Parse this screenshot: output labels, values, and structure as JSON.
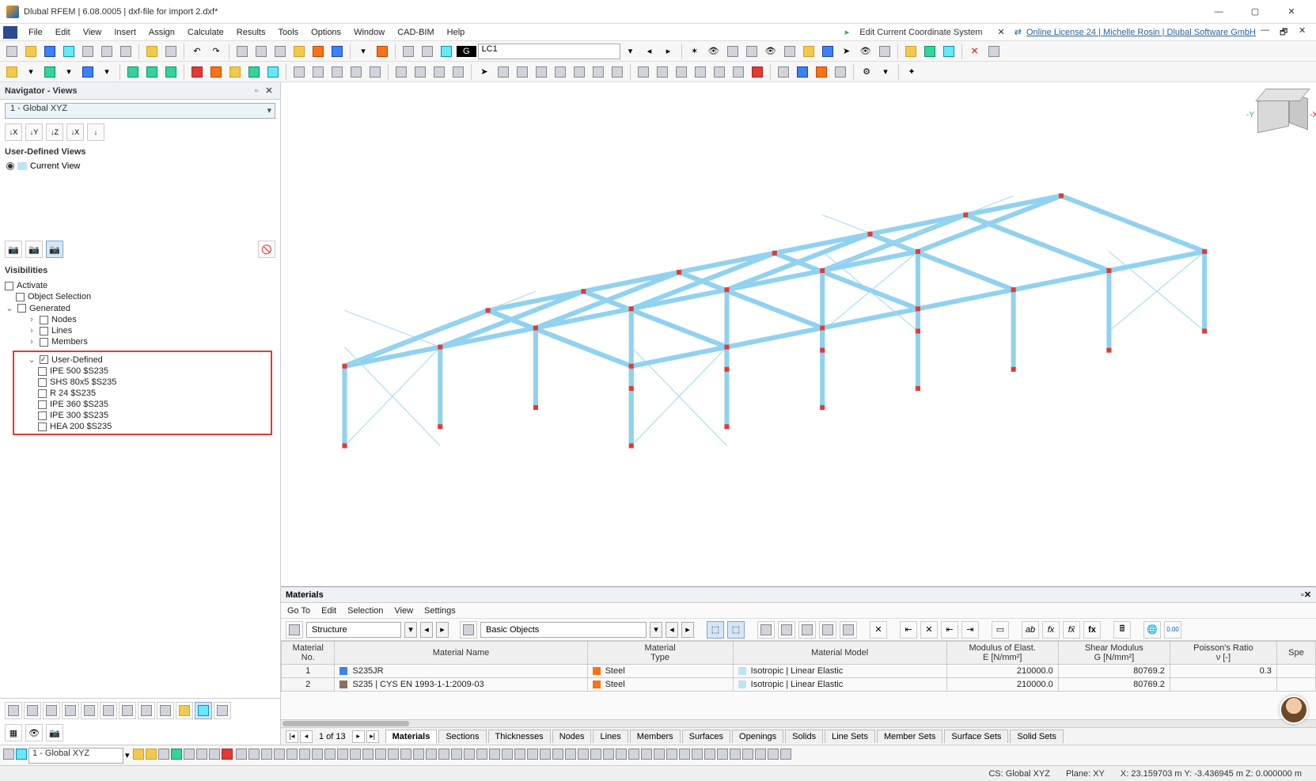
{
  "titlebar": {
    "title": "Dlubal RFEM | 6.08.0005 | dxf-file for import 2.dxf*"
  },
  "menus": [
    "File",
    "Edit",
    "View",
    "Insert",
    "Assign",
    "Calculate",
    "Results",
    "Tools",
    "Options",
    "Window",
    "CAD-BIM",
    "Help"
  ],
  "coord_tab": {
    "label": "Edit Current Coordinate System"
  },
  "license": "Online License 24 | Michelle Rosin | Dlubal Software GmbH",
  "tb2": {
    "gbox": "G",
    "lc": "LC1"
  },
  "navigator": {
    "title": "Navigator - Views",
    "view_combo": "1 - Global XYZ",
    "axis_buttons": [
      "↓X",
      "↓Y",
      "↓Z",
      "↓X",
      "↓"
    ],
    "user_views_title": "User-Defined Views",
    "current_view": "Current View",
    "visibilities_title": "Visibilities",
    "activate": "Activate",
    "obj_sel": "Object Selection",
    "generated": "Generated",
    "gen_children": [
      "Nodes",
      "Lines",
      "Members"
    ],
    "user_defined": "User-Defined",
    "ud_children": [
      "IPE 500 $S235",
      "SHS 80x5 $S235",
      "R 24 $S235",
      "IPE 360 $S235",
      "IPE 300 $S235",
      "HEA 200 $S235"
    ]
  },
  "materials_panel": {
    "title": "Materials",
    "menus": [
      "Go To",
      "Edit",
      "Selection",
      "View",
      "Settings"
    ],
    "combo1": "Structure",
    "combo2": "Basic Objects",
    "headers": {
      "no": "Material\nNo.",
      "name": "Material Name",
      "type": "Material\nType",
      "model": "Material Model",
      "mod": "Modulus of Elast.\nE [N/mm²]",
      "shear": "Shear Modulus\nG [N/mm²]",
      "poisson": "Poisson's Ratio\nν [-]",
      "spe": "Spe"
    },
    "rows": [
      {
        "no": "1",
        "name": "S235JR",
        "name_color": "#3b82f6",
        "type": "Steel",
        "type_color": "#f97316",
        "model": "Isotropic | Linear Elastic",
        "model_color": "#bfe3f7",
        "mod": "210000.0",
        "shear": "80769.2",
        "poisson": "0.3"
      },
      {
        "no": "2",
        "name": "S235 | CYS EN 1993-1-1:2009-03",
        "name_color": "#8d6e63",
        "type": "Steel",
        "type_color": "#f97316",
        "model": "Isotropic | Linear Elastic",
        "model_color": "#bfe3f7",
        "mod": "210000.0",
        "shear": "80769.2",
        "poisson": ""
      }
    ],
    "page": "1 of 13",
    "tabs": [
      "Materials",
      "Sections",
      "Thicknesses",
      "Nodes",
      "Lines",
      "Members",
      "Surfaces",
      "Openings",
      "Solids",
      "Line Sets",
      "Member Sets",
      "Surface Sets",
      "Solid Sets"
    ]
  },
  "bottom_combo": "1 - Global XYZ",
  "statusbar": {
    "cs": "CS: Global XYZ",
    "plane": "Plane: XY",
    "coords": "X: 23.159703 m Y: -3.436945 m Z: 0.000000 m"
  },
  "cube": {
    "y": "-Y",
    "x": "-X"
  }
}
